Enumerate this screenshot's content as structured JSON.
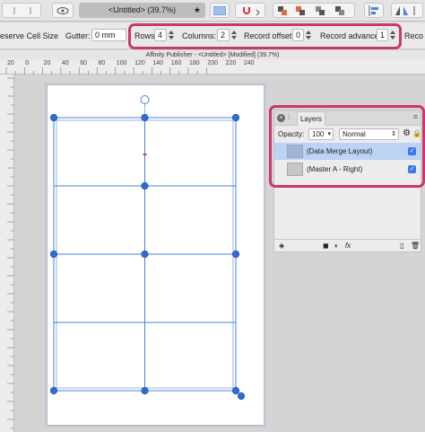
{
  "toolbar": {
    "document_tab": "<Untitled> (39.7%)",
    "tab_star": "★"
  },
  "context_bar": {
    "reserve_cell_size": "eserve Cell Size",
    "gutter_label": "Gutter:",
    "gutter_value": "0 mm",
    "rows_label": "Rows:",
    "rows_value": "4",
    "columns_label": "Columns:",
    "columns_value": "2",
    "record_offset_label": "Record offset:",
    "record_offset_value": "0",
    "record_advance_label": "Record advance:",
    "record_advance_value": "1",
    "overflow_label": "Reco"
  },
  "window_title": "Affinity Publisher - <Untitled> [Modified] (39.7%)",
  "ruler": {
    "labels": [
      "20",
      "0",
      "20",
      "40",
      "60",
      "80",
      "100",
      "120",
      "140",
      "160",
      "180",
      "200",
      "220",
      "240"
    ]
  },
  "layers_panel": {
    "tab_label": "Layers",
    "opacity_label": "Opacity:",
    "opacity_value": "100",
    "blend_mode": "Normal",
    "layers": [
      {
        "name": "(Data Merge Layout)",
        "selected": true
      },
      {
        "name": "(Master A - Right)",
        "selected": false
      }
    ],
    "fx_label": "fx"
  },
  "colors": {
    "highlight": "#c8376d",
    "frame_blue": "#4a7fd4",
    "handle_blue": "#2f6bd0",
    "selected_row": "#bcd3f3"
  }
}
